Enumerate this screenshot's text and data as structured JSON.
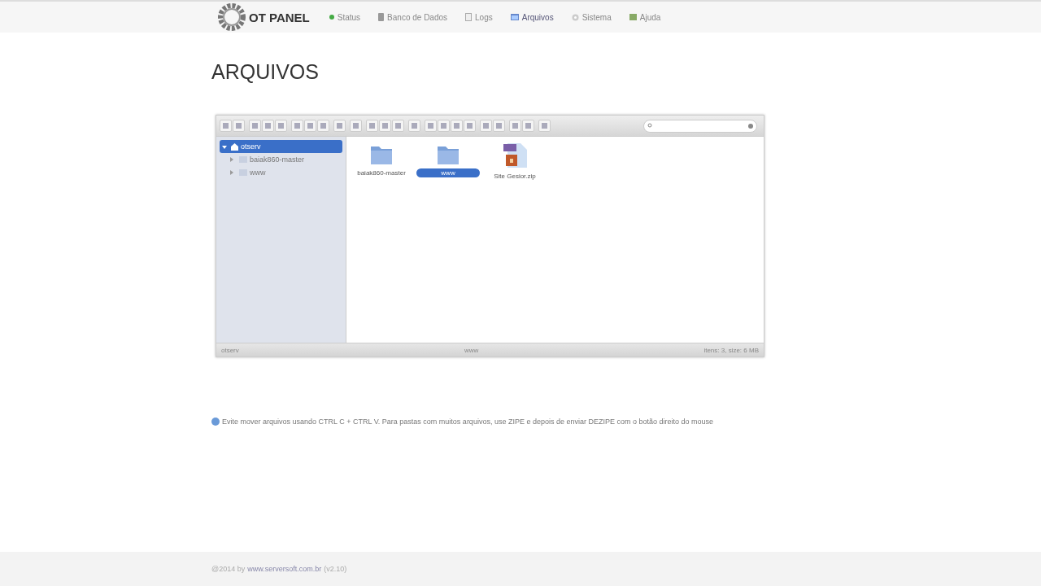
{
  "header": {
    "logo": "OT PANEL",
    "nav": [
      {
        "label": "Status",
        "selected": false
      },
      {
        "label": "Banco de Dados",
        "selected": false
      },
      {
        "label": "Logs",
        "selected": false
      },
      {
        "label": "Arquivos",
        "selected": true
      },
      {
        "label": "Sistema",
        "selected": false
      },
      {
        "label": "Ajuda",
        "selected": false
      }
    ]
  },
  "page_title": "ARQUIVOS",
  "file_manager": {
    "tree": [
      {
        "label": "otserv",
        "selected": true,
        "expanded": true,
        "children": [
          {
            "label": "baiak860-master",
            "selected": false,
            "expanded": false
          },
          {
            "label": "www",
            "selected": false,
            "expanded": false
          }
        ]
      }
    ],
    "files": [
      {
        "name": "baiak860-master",
        "kind": "folder",
        "selected": false
      },
      {
        "name": "www",
        "kind": "folder",
        "selected": true
      },
      {
        "name": "Site Gesior.zip",
        "kind": "archive",
        "selected": false
      }
    ],
    "status_bar": {
      "path": "otserv",
      "selection": "www",
      "summary": "itens: 3, size: 6 MB"
    }
  },
  "note": "Evite mover arquivos usando CTRL C + CTRL V. Para pastas com muitos arquivos, use ZIPE e depois de enviar DEZIPE com o botão direito do mouse",
  "footer": {
    "prefix": "@2014 by",
    "link": "www.serversoft.com.br",
    "suffix": "(v2.10)"
  }
}
